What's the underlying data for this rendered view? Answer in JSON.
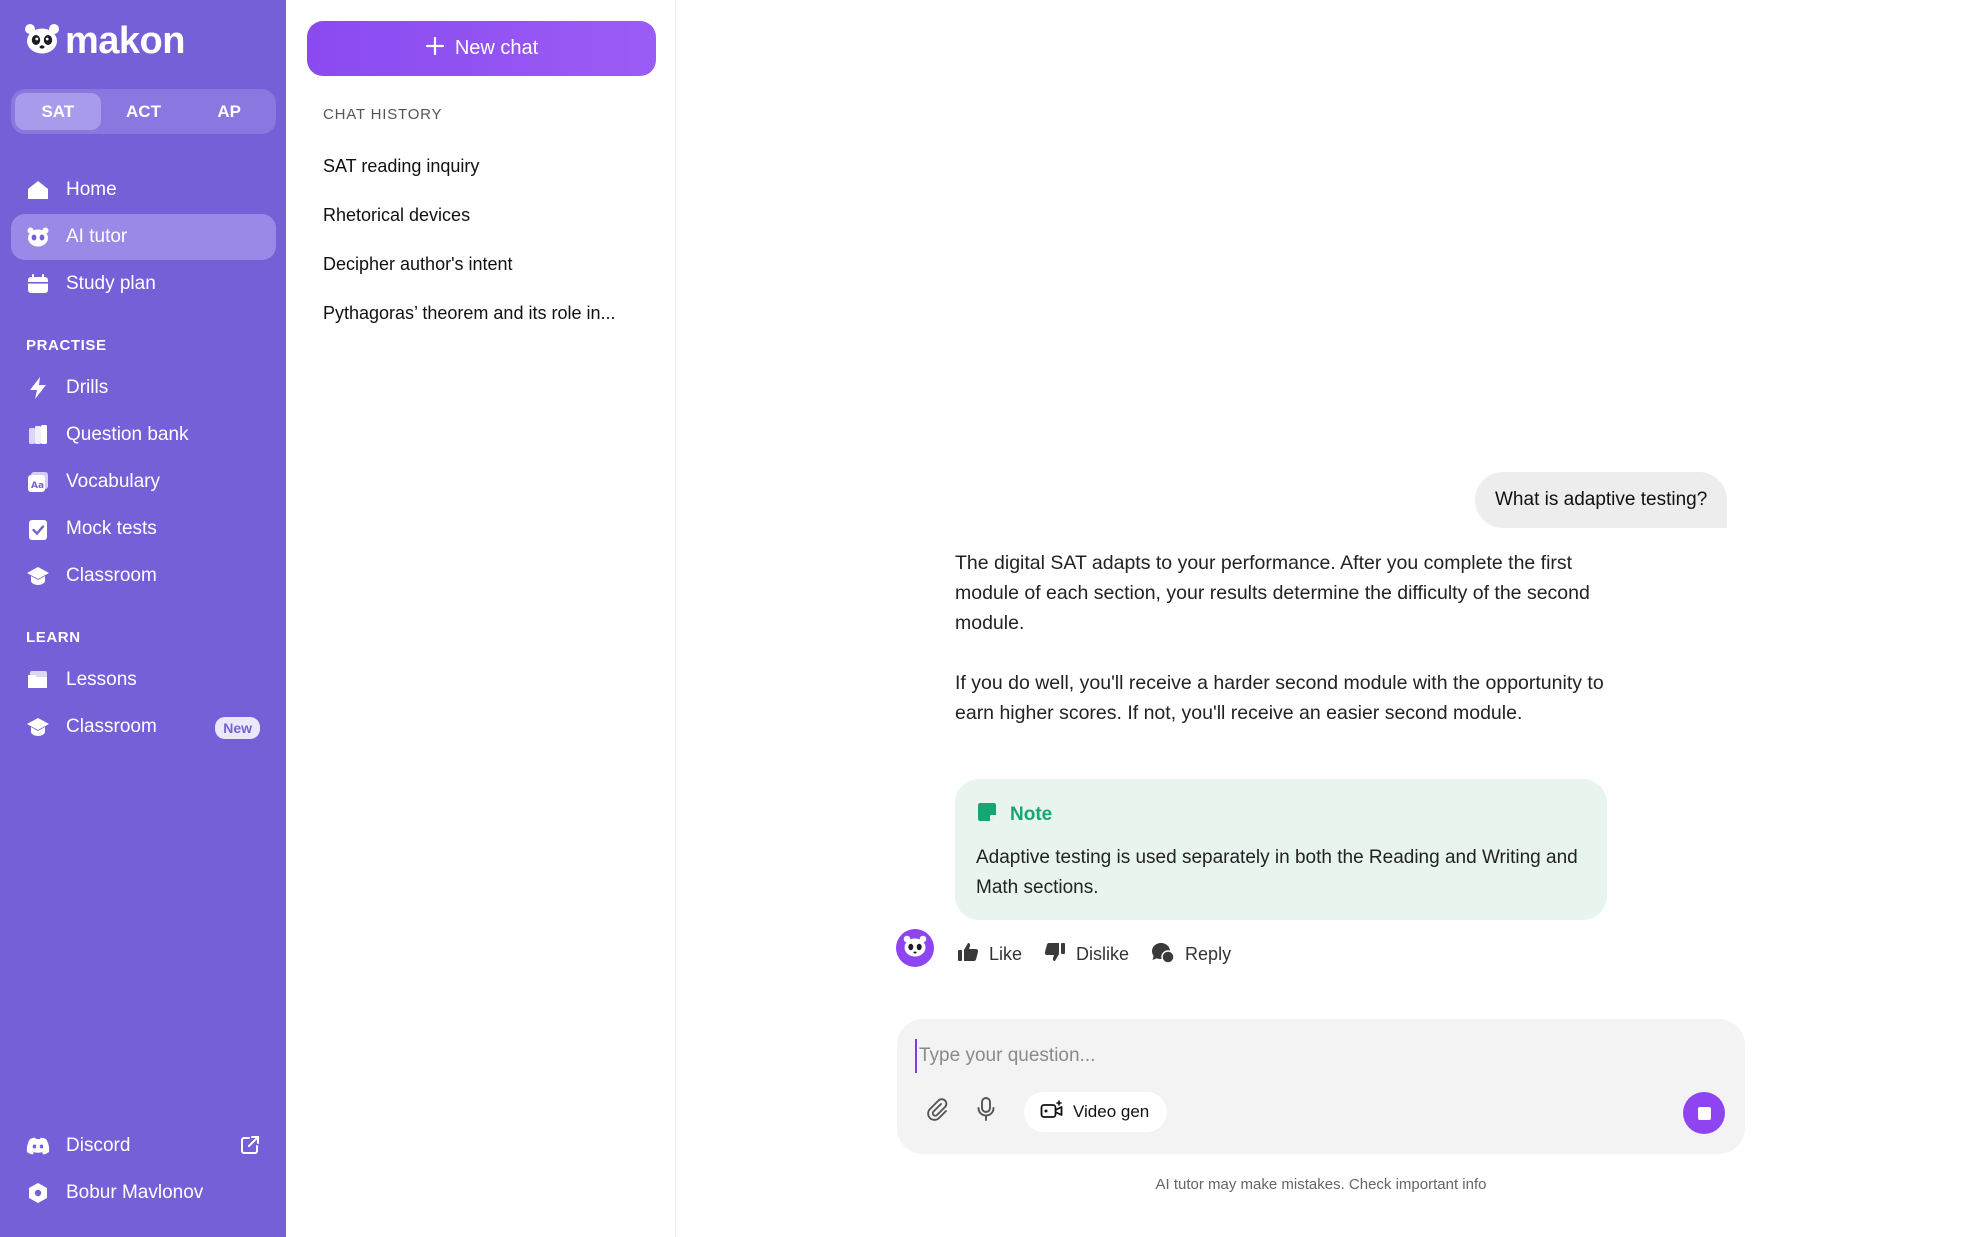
{
  "brand": {
    "name": "makon"
  },
  "exam_tabs": [
    {
      "label": "SAT",
      "active": true
    },
    {
      "label": "ACT",
      "active": false
    },
    {
      "label": "AP",
      "active": false
    }
  ],
  "nav_main": [
    {
      "label": "Home",
      "icon": "home-icon"
    },
    {
      "label": "AI tutor",
      "icon": "panda-icon",
      "active": true
    },
    {
      "label": "Study plan",
      "icon": "calendar-icon"
    }
  ],
  "practise": {
    "label": "PRACTISE",
    "items": [
      {
        "label": "Drills",
        "icon": "lightning-icon"
      },
      {
        "label": "Question bank",
        "icon": "question-bank-icon"
      },
      {
        "label": "Vocabulary",
        "icon": "vocabulary-icon"
      },
      {
        "label": "Mock tests",
        "icon": "clipboard-check-icon"
      },
      {
        "label": "Classroom",
        "icon": "graduation-cap-icon"
      }
    ]
  },
  "learn": {
    "label": "LEARN",
    "items": [
      {
        "label": "Lessons",
        "icon": "folder-icon"
      },
      {
        "label": "Classroom",
        "icon": "graduation-cap-icon",
        "badge": "New"
      }
    ]
  },
  "sidebar_footer": [
    {
      "label": "Discord",
      "icon": "discord-icon"
    },
    {
      "label": "Bobur Mavlonov",
      "icon": "user-hexagon-icon"
    }
  ],
  "history": {
    "new_chat_label": "New chat",
    "title": "CHAT HISTORY",
    "items": [
      "SAT reading inquiry",
      "Rhetorical devices",
      "Decipher author's intent",
      "Pythagoras’ theorem and its role in..."
    ]
  },
  "chat": {
    "user_message": "What is adaptive testing?",
    "answer_paragraphs": [
      "The digital SAT adapts to your performance. After you complete the first module of each section, your results determine the difficulty of the second module.",
      "If you do well, you'll receive a harder second module with the opportunity to earn higher scores. If not, you'll receive an easier second module."
    ],
    "note": {
      "title": "Note",
      "body": "Adaptive testing is used separately in both the Reading and Writing and Math sections."
    },
    "actions": {
      "like": "Like",
      "dislike": "Dislike",
      "reply": "Reply"
    }
  },
  "composer": {
    "placeholder": "Type your question...",
    "video_gen_label": "Video gen",
    "disclaimer": "AI tutor may make mistakes. Check important info"
  },
  "colors": {
    "sidebar": "#7660d8",
    "accent": "#8e44f0",
    "note_bg": "#e8f5ef",
    "note_green": "#16a673"
  }
}
